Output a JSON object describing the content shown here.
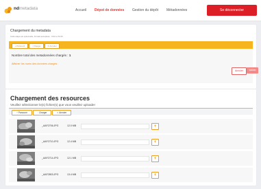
{
  "navbar": {
    "brand": "nd",
    "brand_sub": "metadata",
    "links": [
      "Accueil",
      "Dépot de données",
      "Gestion du dépôt",
      "Métadonnées"
    ],
    "active_index": 1,
    "logout": "Se déconnecter"
  },
  "metadata_card": {
    "title": "Chargement du metadata",
    "subtitle": "Cette étape est optionnelle, formats acceptées : CSV et XLSX",
    "toolbar": [
      "+ Parcourir",
      "↑ Charger",
      "✕ Annuler"
    ],
    "total_label": "Nombre total des metadonnées chargés :",
    "total_value": "1",
    "show_link": "Afficher les noms des données chargés",
    "annuler": "Annuler",
    "valider": "Valider"
  },
  "resources_card": {
    "title": "Chargement des resources",
    "subtitle": "Veuillez sélectionner le(s) fichier(s) que vous veuillez uploader",
    "toolbar": [
      {
        "icon": "+",
        "label": "Parcourir"
      },
      {
        "icon": "↑",
        "label": "Charger"
      },
      {
        "icon": "✕",
        "label": "Annuler"
      }
    ],
    "files": [
      {
        "name": "_AAF2706.JPG",
        "size": "12.0 MB",
        "progress": 0
      },
      {
        "name": "_AAF2710.JPG",
        "size": "12.4 MB",
        "progress": 0
      },
      {
        "name": "_AAF2714.JPG",
        "size": "12.1 MB",
        "progress": 0
      },
      {
        "name": "_AAF2803.JPG",
        "size": "13.4 MB",
        "progress": 0
      }
    ],
    "add_label": "+"
  },
  "colors": {
    "accent": "#f6b51e",
    "danger": "#dc1f26",
    "active_link": "#e53935"
  }
}
